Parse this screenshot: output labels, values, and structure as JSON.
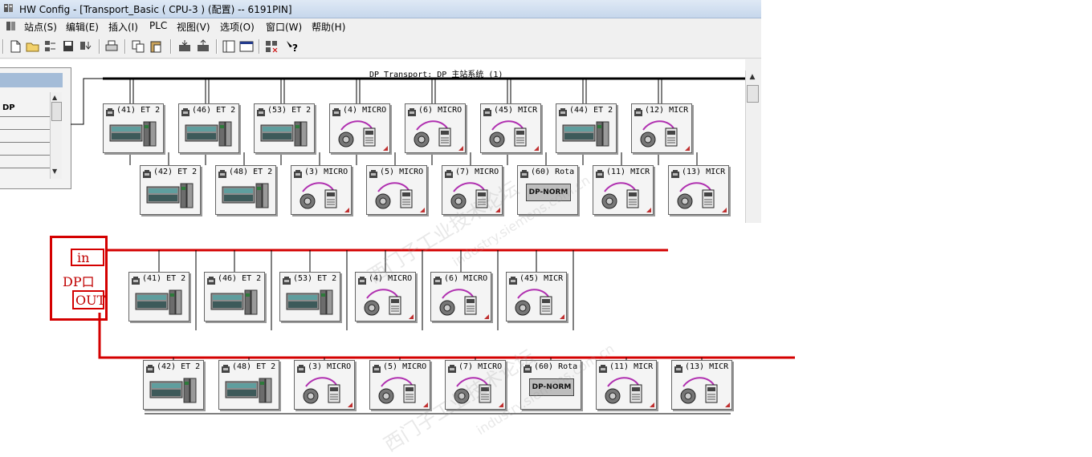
{
  "window": {
    "title": "HW Config - [Transport_Basic ( CPU-3 ) (配置) -- 6191PIN]"
  },
  "menu": {
    "items": [
      "站点(S)",
      "编辑(E)",
      "插入(I)",
      "PLC",
      "视图(V)",
      "选项(O)",
      "窗口(W)",
      "帮助(H)"
    ]
  },
  "catalog": {
    "selected": "DP"
  },
  "network": {
    "label": "DP_Transport: DP 主站系统 (1)"
  },
  "top_row1": [
    {
      "label": "(41) ET 2",
      "kind": "et200"
    },
    {
      "label": "(46) ET 2",
      "kind": "et200"
    },
    {
      "label": "(53) ET 2",
      "kind": "et200"
    },
    {
      "label": "(4) MICRO",
      "kind": "micro"
    },
    {
      "label": "(6) MICRO",
      "kind": "micro"
    },
    {
      "label": "(45) MICR",
      "kind": "micro"
    },
    {
      "label": "(44) ET 2",
      "kind": "et200"
    },
    {
      "label": "(12) MICR",
      "kind": "micro"
    }
  ],
  "top_row2": [
    {
      "label": "(42) ET 2",
      "kind": "et200"
    },
    {
      "label": "(48) ET 2",
      "kind": "et200"
    },
    {
      "label": "(3) MICRO",
      "kind": "micro"
    },
    {
      "label": "(5) MICRO",
      "kind": "micro"
    },
    {
      "label": "(7) MICRO",
      "kind": "micro"
    },
    {
      "label": "(60) Rota",
      "kind": "dpnorm"
    },
    {
      "label": "(11) MICR",
      "kind": "micro"
    },
    {
      "label": "(13) MICR",
      "kind": "micro"
    }
  ],
  "bottom_row1": [
    {
      "label": "(41) ET 2",
      "kind": "et200"
    },
    {
      "label": "(46) ET 2",
      "kind": "et200"
    },
    {
      "label": "(53) ET 2",
      "kind": "et200"
    },
    {
      "label": "(4) MICRO",
      "kind": "micro"
    },
    {
      "label": "(6) MICRO",
      "kind": "micro"
    },
    {
      "label": "(45) MICR",
      "kind": "micro"
    }
  ],
  "bottom_row2": [
    {
      "label": "(42) ET 2",
      "kind": "et200"
    },
    {
      "label": "(48) ET 2",
      "kind": "et200"
    },
    {
      "label": "(3) MICRO",
      "kind": "micro"
    },
    {
      "label": "(5) MICRO",
      "kind": "micro"
    },
    {
      "label": "(7) MICRO",
      "kind": "micro"
    },
    {
      "label": "(60) Rota",
      "kind": "dpnorm"
    },
    {
      "label": "(11) MICR",
      "kind": "micro"
    },
    {
      "label": "(13) MICR",
      "kind": "micro"
    }
  ],
  "dpnorm_text": "DP-NORM",
  "annotation": {
    "in": "in",
    "port": "DP口",
    "out": "OUT",
    "color": "#d40000"
  },
  "watermark": {
    "site": "industry.siemens.com.cn",
    "brand": "西门子工业技术论坛"
  }
}
